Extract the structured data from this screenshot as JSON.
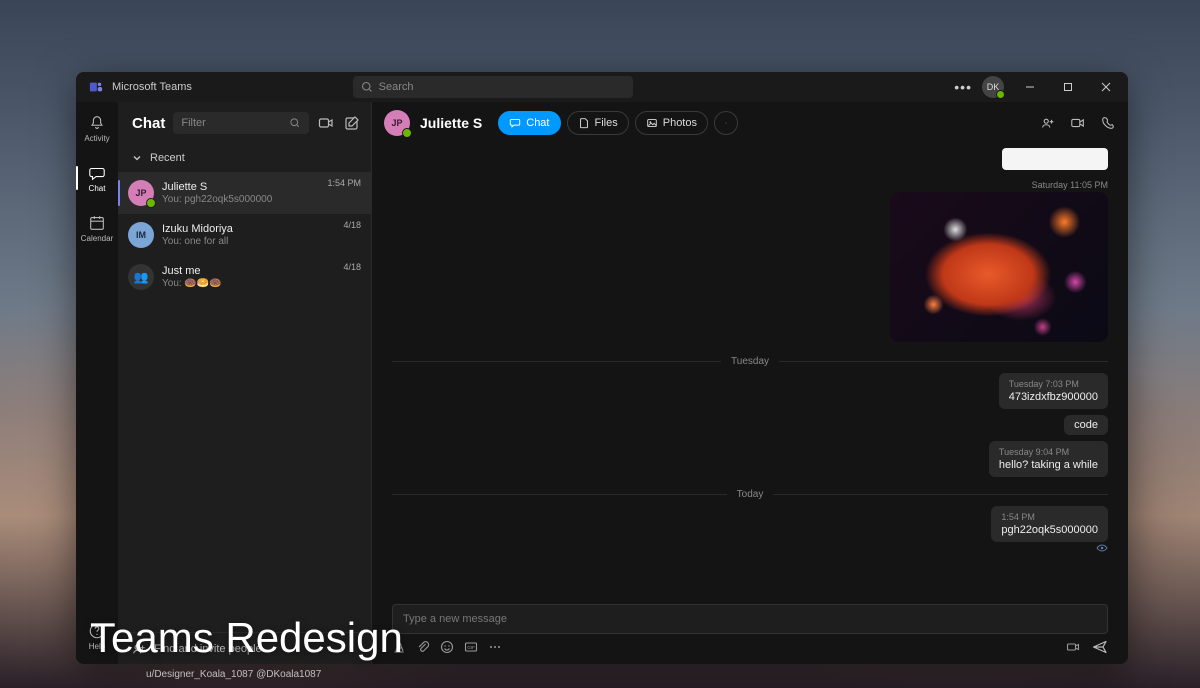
{
  "app": {
    "name": "Microsoft Teams"
  },
  "search": {
    "placeholder": "Search"
  },
  "user": {
    "initials": "DK"
  },
  "rail": {
    "activity": "Activity",
    "chat": "Chat",
    "calendar": "Calendar",
    "help": "Help"
  },
  "chat_panel": {
    "title": "Chat",
    "filter_placeholder": "Filter",
    "recent_label": "Recent",
    "invite_label": "Find and invite people",
    "items": [
      {
        "initials": "JP",
        "name": "Juliette S",
        "preview": "You: pgh22oqk5s000000",
        "time": "1:54 PM"
      },
      {
        "initials": "IM",
        "name": "Izuku Midoriya",
        "preview": "You: one for all",
        "time": "4/18"
      },
      {
        "initials": "👥",
        "name": "Just me",
        "preview": "You: 🍩🥯🍩",
        "time": "4/18"
      }
    ]
  },
  "conversation": {
    "contact_initials": "JP",
    "contact_name": "Juliette S",
    "tabs": {
      "chat": "Chat",
      "files": "Files",
      "photos": "Photos"
    },
    "timeline": {
      "sat_ts": "Saturday 11:05 PM",
      "sep_tuesday": "Tuesday",
      "sep_today": "Today"
    },
    "messages": [
      {
        "ts": "Tuesday 7:03 PM",
        "text": "473izdxfbz900000"
      },
      {
        "ts": "",
        "text": "code"
      },
      {
        "ts": "Tuesday 9:04 PM",
        "text": "hello? taking a while"
      },
      {
        "ts": "1:54 PM",
        "text": "pgh22oqk5s000000"
      }
    ],
    "composer_placeholder": "Type a new message"
  },
  "overlay": {
    "title": "Teams Redesign",
    "credit": "u/Designer_Koala_1087 @DKoala1087"
  }
}
